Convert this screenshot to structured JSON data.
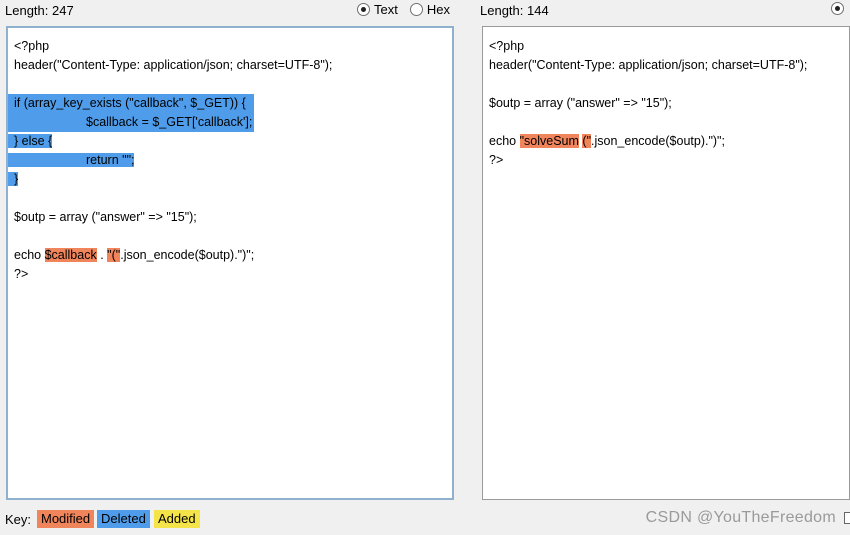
{
  "left": {
    "length_label": "Length: 247",
    "view_options": [
      {
        "label": "Text",
        "checked": true
      },
      {
        "label": "Hex",
        "checked": false
      }
    ],
    "lines": {
      "l1": "<?php",
      "l2": "header(\"Content-Type: application/json; charset=UTF-8\");",
      "l4": "if (array_key_exists (\"callback\", $_GET)) {",
      "l5": "$callback = $_GET['callback'];",
      "l6": "} else {",
      "l7": "return \"\";",
      "l8": "}",
      "l10": "$outp = array (\"answer\" => \"15\");",
      "l12_prefix": "echo ",
      "l12_mod1": "$callback",
      "l12_sep": " ",
      "l12_dot": ".",
      "l12_gap": " ",
      "l12_mod2": "\"(\"",
      "l12_suffix": ".json_encode($outp).\")\";",
      "l13": "?>"
    }
  },
  "right": {
    "length_label": "Length: 144",
    "radio_checked": true,
    "lines": {
      "l1": "<?php",
      "l2": "header(\"Content-Type: application/json; charset=UTF-8\");",
      "l4": "$outp = array (\"answer\" => \"15\");",
      "l6_prefix": "echo ",
      "l6_mod1": "\"solveSum",
      "l6_gap": " ",
      "l6_mod2": "(\"",
      "l6_suffix": ".json_encode($outp).\")\";",
      "l7": "?>"
    }
  },
  "footer": {
    "key_label": "Key:",
    "keys": {
      "modified": "Modified",
      "deleted": "Deleted",
      "added": "Added"
    },
    "watermark": "CSDN @YouTheFreedom"
  },
  "colors": {
    "modified": "#f0845a",
    "deleted": "#4f9dea",
    "added": "#f4e44a"
  }
}
